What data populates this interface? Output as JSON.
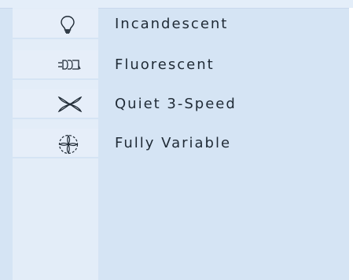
{
  "options": [
    {
      "icon": "light-bulb-icon",
      "label": "Incandescent"
    },
    {
      "icon": "fluorescent-tube-icon",
      "label": "Fluorescent"
    },
    {
      "icon": "fan-blades-icon",
      "label": "Quiet 3-Speed"
    },
    {
      "icon": "fan-variable-icon",
      "label": "Fully Variable"
    }
  ],
  "colors": {
    "panel": "#d5e4f4",
    "icon_column": "#e3edf8",
    "text": "#1f2a35"
  }
}
